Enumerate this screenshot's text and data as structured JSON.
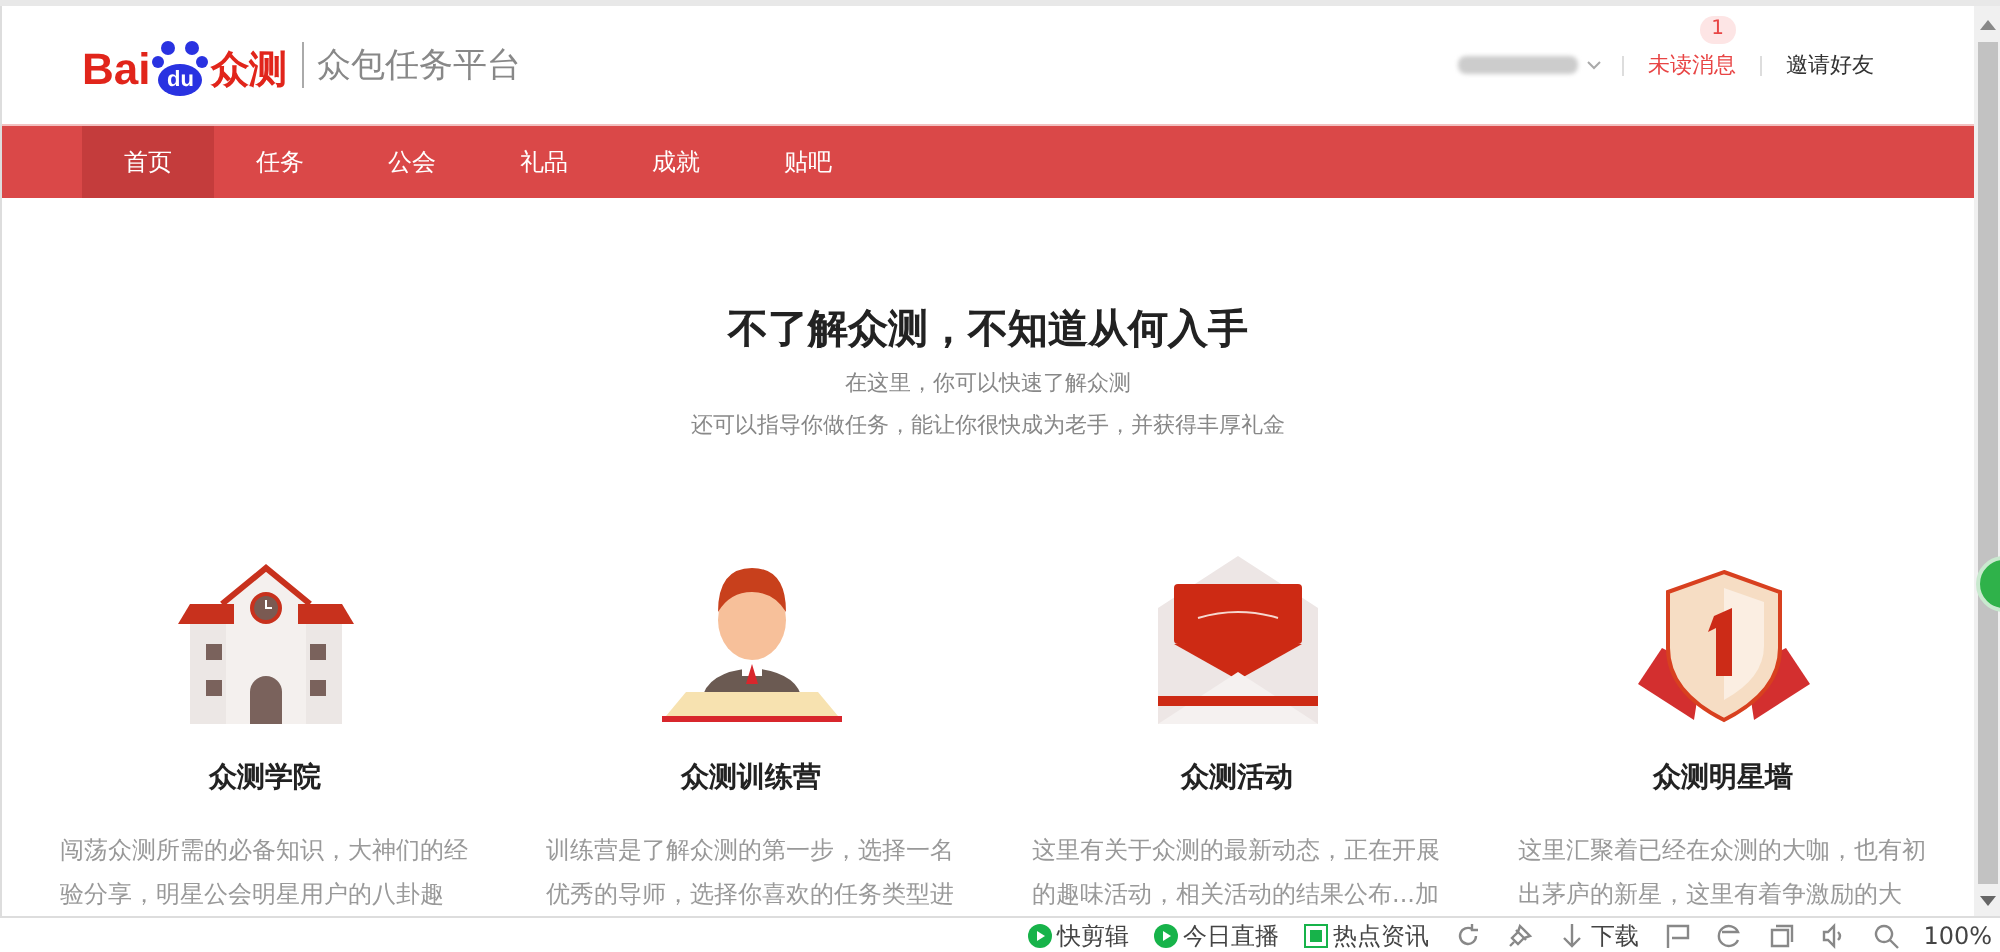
{
  "header": {
    "logo": {
      "brand": "Bai",
      "brand_badge": "du",
      "product": "众测"
    },
    "subtitle": "众包任务平台",
    "user_menu": {
      "redacted": true
    },
    "messages": {
      "label": "未读消息",
      "count": "1"
    },
    "invite": "邀请好友"
  },
  "nav": [
    {
      "label": "首页",
      "selected": true
    },
    {
      "label": "任务",
      "selected": false
    },
    {
      "label": "公会",
      "selected": false
    },
    {
      "label": "礼品",
      "selected": false
    },
    {
      "label": "成就",
      "selected": false
    },
    {
      "label": "贴吧",
      "selected": false
    }
  ],
  "intro": {
    "title": "不了解众测，不知道从何入手",
    "lines": [
      "在这里，你可以快速了解众测",
      "还可以指导你做任务，能让你很快成为老手，并获得丰厚礼金"
    ]
  },
  "cards": [
    {
      "kind": "school",
      "title": "众测学院",
      "description": "闯荡众测所需的必备知识，大神们的经验分享，明星公会明星用户的八卦趣"
    },
    {
      "kind": "mentor",
      "title": "众测训练营",
      "description": "训练营是了解众测的第一步，选择一名优秀的导师，选择你喜欢的任务类型进"
    },
    {
      "kind": "invitation",
      "title": "众测活动",
      "description": "这里有关于众测的最新动态，正在开展的趣味活动，相关活动的结果公布...加"
    },
    {
      "kind": "medal",
      "title": "众测明星墙",
      "description": "这里汇聚着已经在众测的大咖，也有初出茅庐的新星，这里有着争激励的大"
    }
  ],
  "status_bar": {
    "items": [
      {
        "kind": "play",
        "label": "快剪辑"
      },
      {
        "kind": "play",
        "label": "今日直播"
      },
      {
        "kind": "news",
        "label": "热点资讯"
      }
    ],
    "download": "下载",
    "zoom": "100%"
  }
}
